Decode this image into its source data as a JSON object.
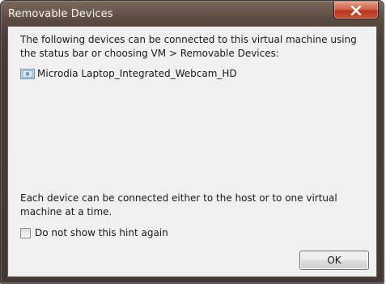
{
  "window": {
    "title": "Removable Devices"
  },
  "content": {
    "intro": "The following devices can be connected to this virtual machine using the status bar or choosing VM > Removable Devices:",
    "devices": [
      {
        "label": "Microdia Laptop_Integrated_Webcam_HD",
        "icon": "webcam-device-icon"
      }
    ],
    "hint": "Each device can be connected either to the host or to one virtual machine at a time.",
    "checkbox": {
      "label": "Do not show this hint again",
      "checked": false
    },
    "ok_label": "OK"
  },
  "colors": {
    "close_button": "#c9523a",
    "title_text": "#f3ede6",
    "dialog_background": "#f0f0f0"
  }
}
